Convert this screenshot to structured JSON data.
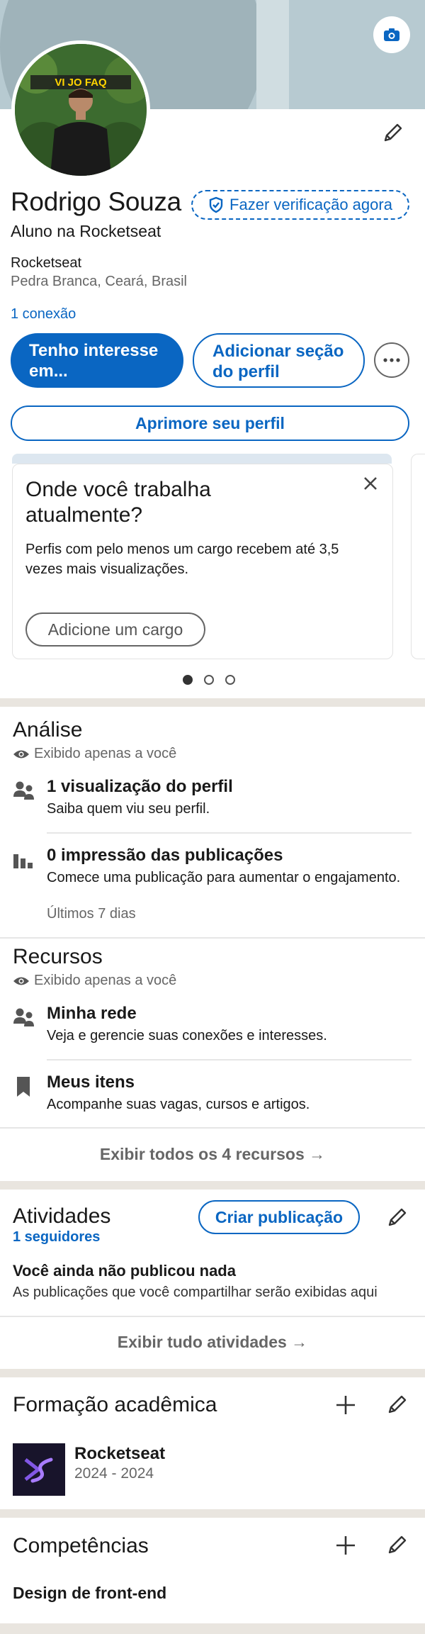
{
  "profile": {
    "name": "Rodrigo Souza",
    "verify_label": "Fazer verificação agora",
    "headline": "Aluno na Rocketseat",
    "company": "Rocketseat",
    "location": "Pedra Branca, Ceará, Brasil",
    "connections": "1 conexão",
    "avatar_banner_text": "VI JO FAQ"
  },
  "actions": {
    "interest_label": "Tenho interesse em...",
    "add_section_label": "Adicionar seção do perfil",
    "improve_label": "Aprimore seu perfil"
  },
  "suggestion_card": {
    "title": "Onde você trabalha atualmente?",
    "text": "Perfis com pelo menos um cargo recebem até 3,5 vezes mais visualizações.",
    "button": "Adicione um cargo",
    "pages": 3,
    "active_page": 1
  },
  "analytics": {
    "title": "Análise",
    "visibility": "Exibido apenas a você",
    "items": [
      {
        "title": "1 visualização do perfil",
        "subtitle": "Saiba quem viu seu perfil.",
        "icon": "people-icon"
      },
      {
        "title": "0 impressão das publicações",
        "subtitle": "Comece uma publicação para aumentar o engajamento.",
        "note": "Últimos 7 dias",
        "icon": "bar-chart-icon"
      }
    ]
  },
  "resources": {
    "title": "Recursos",
    "visibility": "Exibido apenas a você",
    "items": [
      {
        "title": "Minha rede",
        "subtitle": "Veja e gerencie suas conexões e interesses.",
        "icon": "people-icon"
      },
      {
        "title": "Meus itens",
        "subtitle": "Acompanhe suas vagas, cursos e artigos.",
        "icon": "bookmark-icon"
      }
    ],
    "show_all": "Exibir todos os 4 recursos →"
  },
  "activity": {
    "title": "Atividades",
    "create_post": "Criar publicação",
    "followers": "1 seguidores",
    "empty_title": "Você ainda não publicou nada",
    "empty_text": "As publicações que você compartilhar serão exibidas aqui",
    "show_all": "Exibir tudo atividades →"
  },
  "education": {
    "title": "Formação acadêmica",
    "items": [
      {
        "school": "Rocketseat",
        "years": "2024 - 2024"
      }
    ]
  },
  "skills": {
    "title": "Competências",
    "items": [
      "Design de front-end"
    ]
  },
  "colors": {
    "accent": "#0a66c2",
    "separator": "#e9e5df",
    "muted": "#666666"
  }
}
